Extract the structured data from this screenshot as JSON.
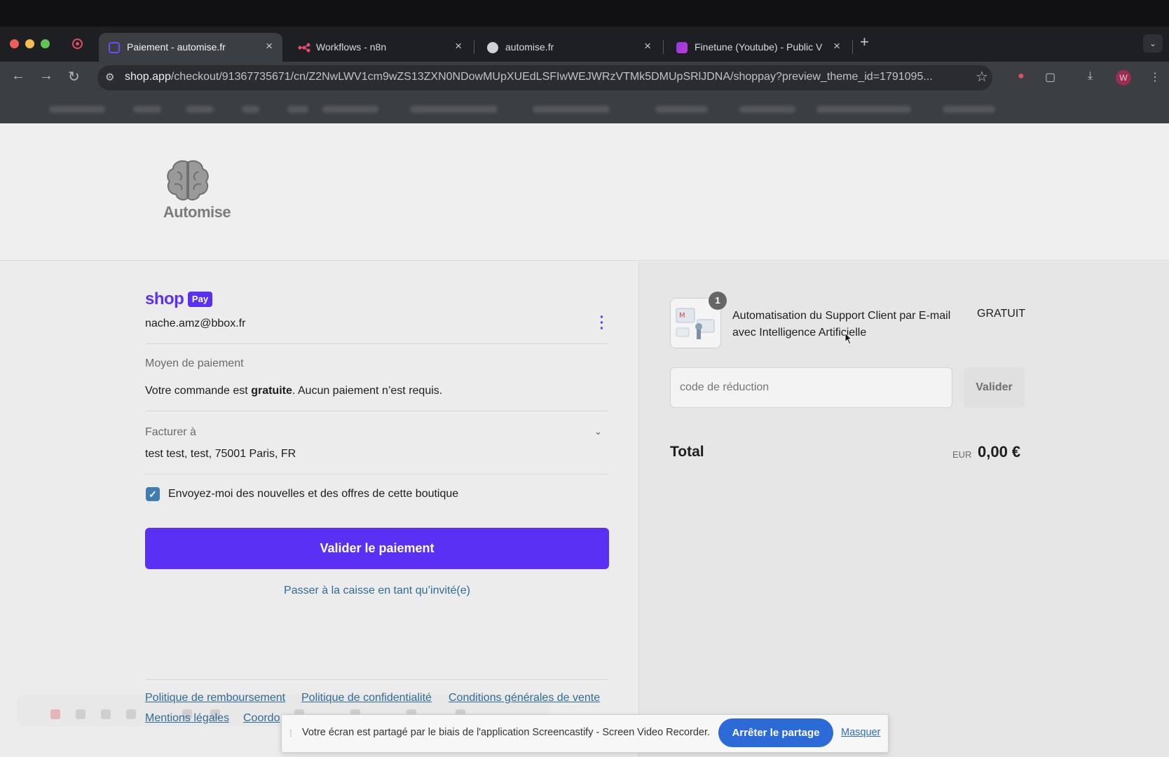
{
  "browser": {
    "tabs": [
      {
        "title": "Paiement - automise.fr",
        "active": true
      },
      {
        "title": "Workflows - n8n",
        "active": false
      },
      {
        "title": "automise.fr",
        "active": false
      },
      {
        "title": "Finetune (Youtube) - Public V",
        "active": false
      }
    ],
    "close_glyph": "×",
    "new_tab_glyph": "+",
    "url_host": "shop.app",
    "url_path": "/checkout/91367735671/cn/Z2NwLWV1cm9wZS13ZXN0NDowMUpXUEdLSFIwWEJWRzVTMk5DMUpSRlJDNA/shoppay?preview_theme_id=1791095...",
    "profile_initial": "W"
  },
  "header": {
    "logo_text": "Automise"
  },
  "left": {
    "shop_word": "shop",
    "pay_word": "Pay",
    "email": "nache.amz@bbox.fr",
    "payment_method_label": "Moyen de paiement",
    "order_free_prefix": "Votre commande est ",
    "order_free_bold": "gratuite",
    "order_free_suffix": ". Aucun paiement n’est requis.",
    "bill_to_label": "Facturer à",
    "billing_address": "test test, test, 75001 Paris, FR",
    "newsletter_label": "Envoyez-moi des nouvelles et des offres de cette boutique",
    "newsletter_checked": true,
    "submit_label": "Valider le paiement",
    "guest_link": "Passer à la caisse en tant qu’invité(e)",
    "footer_links": [
      "Politique de remboursement",
      "Politique de confidentialité",
      "Conditions générales de vente",
      "Mentions légales",
      "Coordo"
    ]
  },
  "right": {
    "product_qty": "1",
    "product_name": "Automatisation du Support Client par E-mail avec Intelligence Artificielle",
    "product_price": "GRATUIT",
    "discount_placeholder": "code de réduction",
    "apply_label": "Valider",
    "total_label": "Total",
    "currency": "EUR",
    "total_value": "0,00 €"
  },
  "share_bar": {
    "message": "Votre écran est partagé par le biais de l'application Screencastify - Screen Video Recorder.",
    "stop_label": "Arrêter le partage",
    "hide_label": "Masquer"
  },
  "colors": {
    "shop_purple": "#5a31f4",
    "link_blue": "#2f6c97",
    "share_blue": "#2b6ad7"
  }
}
